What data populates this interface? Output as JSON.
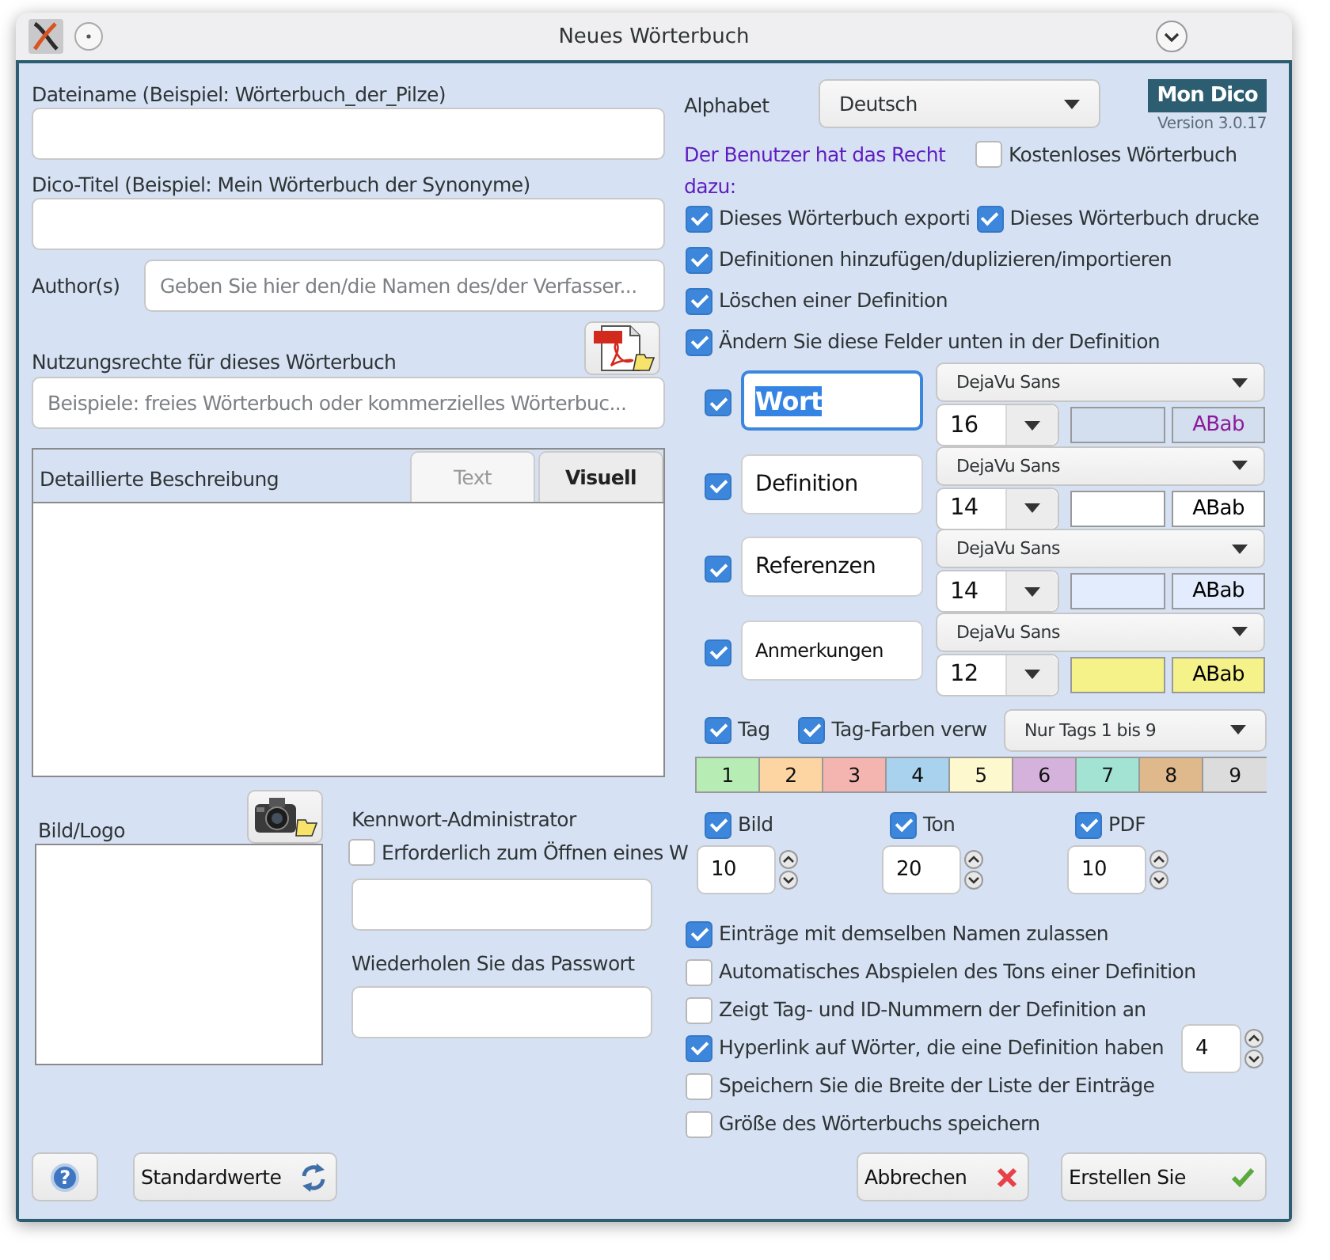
{
  "window": {
    "title": "Neues Wörterbuch"
  },
  "file_name": {
    "label": "Dateiname (Beispiel: Wörterbuch_der_Pilze)"
  },
  "dico_title": {
    "label": "Dico-Titel (Beispiel: Mein Wörterbuch der Synonyme)"
  },
  "authors": {
    "label": "Author(s)",
    "placeholder": "Geben Sie hier den/die Namen des/der Verfasser..."
  },
  "usage_rights": {
    "label": "Nutzungsrechte für dieses Wörterbuch",
    "placeholder": "Beispiele: freies Wörterbuch oder kommerzielles Wörterbuc..."
  },
  "description": {
    "label": "Detaillierte Beschreibung",
    "tabs": [
      {
        "label": "Text",
        "selected": false
      },
      {
        "label": "Visuell",
        "selected": true
      }
    ]
  },
  "image": {
    "label": "Bild/Logo"
  },
  "password": {
    "label": "Kennwort-Administrator",
    "required": {
      "label": "Erforderlich zum Öffnen eines W",
      "checked": false
    },
    "repeat_label": "Wiederholen Sie das Passwort"
  },
  "alphabet": {
    "label": "Alphabet",
    "value": "Deutsch"
  },
  "logo": {
    "name": "Mon Dico",
    "version": "Version 3.0.17"
  },
  "rights": {
    "heading": "Der Benutzer hat das Recht dazu:",
    "free": {
      "label": "Kostenloses Wörterbuch",
      "checked": false
    },
    "rows": [
      [
        {
          "label": "Dieses Wörterbuch exporti",
          "checked": true
        },
        {
          "label": "Dieses Wörterbuch drucke",
          "checked": true
        }
      ],
      [
        {
          "label": "Definitionen hinzufügen/duplizieren/importieren",
          "checked": true
        }
      ],
      [
        {
          "label": "Löschen einer Definition",
          "checked": true
        }
      ],
      [
        {
          "label": "Ändern Sie diese Felder unten in der Definition",
          "checked": true
        }
      ]
    ]
  },
  "fields": [
    {
      "name": "Wort",
      "checked": true,
      "focused": true,
      "bold": true,
      "font": "DejaVu Sans",
      "size": "16",
      "color": "#d3deef",
      "sample": {
        "text": "ABab",
        "color": "#8b1a9a"
      }
    },
    {
      "name": "Definition",
      "checked": true,
      "focused": false,
      "bold": false,
      "font": "DejaVu Sans",
      "size": "14",
      "color": "#ffffff",
      "sample": {
        "text": "ABab",
        "color": "#000000"
      }
    },
    {
      "name": "Referenzen",
      "checked": true,
      "focused": false,
      "bold": false,
      "font": "DejaVu Sans",
      "size": "14",
      "color": "#e2ecfd",
      "sample": {
        "text": "ABab",
        "color": "#000000"
      }
    },
    {
      "name": "Anmerkungen",
      "checked": true,
      "focused": false,
      "bold": false,
      "font": "DejaVu Sans",
      "size": "12",
      "color": "#f5f28a",
      "sample": {
        "text": "ABab",
        "color": "#000000"
      }
    }
  ],
  "tags": {
    "tag": {
      "label": "Tag",
      "checked": true
    },
    "tag_colors": {
      "label": "Tag-Farben verw",
      "checked": true
    },
    "filter": "Nur Tags 1 bis 9",
    "items": [
      {
        "label": "1",
        "color": "#b7ecb4"
      },
      {
        "label": "2",
        "color": "#fcd5a3"
      },
      {
        "label": "3",
        "color": "#f4b5b0"
      },
      {
        "label": "4",
        "color": "#a9d2ee"
      },
      {
        "label": "5",
        "color": "#fef8cf"
      },
      {
        "label": "6",
        "color": "#d4b2dc"
      },
      {
        "label": "7",
        "color": "#a2e3d4"
      },
      {
        "label": "8",
        "color": "#dfb88c"
      },
      {
        "label": "9",
        "color": "#dcdcdc"
      }
    ]
  },
  "media": [
    {
      "label": "Bild",
      "checked": true,
      "value": "10"
    },
    {
      "label": "Ton",
      "checked": true,
      "value": "20"
    },
    {
      "label": "PDF",
      "checked": true,
      "value": "10"
    }
  ],
  "options": [
    {
      "label": "Einträge mit demselben Namen zulassen",
      "checked": true
    },
    {
      "label": "Automatisches Abspielen des Tons einer Definition",
      "checked": false
    },
    {
      "label": "Zeigt Tag- und ID-Nummern der Definition an",
      "checked": false
    },
    {
      "label": "Hyperlink auf Wörter, die eine Definition haben",
      "checked": true,
      "value": "4"
    },
    {
      "label": "Speichern Sie die Breite der Liste der Einträge",
      "checked": false
    },
    {
      "label": "Größe des Wörterbuchs speichern",
      "checked": false
    }
  ],
  "footer": {
    "help": "?",
    "defaults": "Standardwerte",
    "cancel": "Abbrechen",
    "create": "Erstellen Sie"
  }
}
